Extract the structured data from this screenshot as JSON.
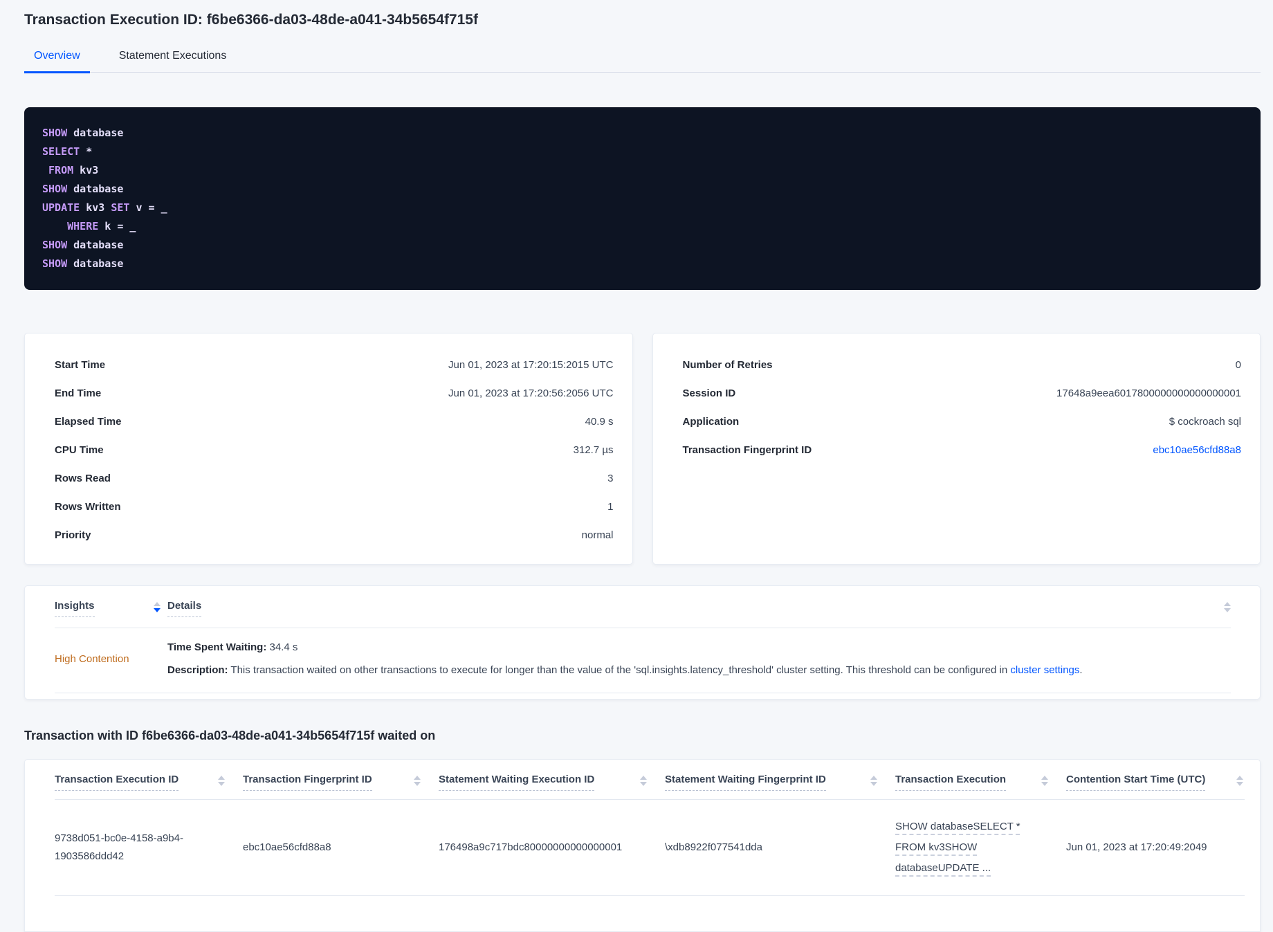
{
  "header": {
    "title": "Transaction Execution ID: f6be6366-da03-48de-a041-34b5654f715f",
    "tabs": [
      {
        "label": "Overview",
        "active": true
      },
      {
        "label": "Statement Executions",
        "active": false
      }
    ]
  },
  "sql": {
    "lines": [
      {
        "parts": [
          {
            "text": "SHOW"
          },
          {
            "text": " database"
          }
        ]
      },
      {
        "parts": [
          {
            "text": "SELECT"
          },
          {
            "text": " *"
          }
        ]
      },
      {
        "parts": [
          {
            "text": " "
          },
          {
            "text": "FROM"
          },
          {
            "text": " kv3"
          }
        ]
      },
      {
        "parts": [
          {
            "text": "SHOW"
          },
          {
            "text": " database"
          }
        ]
      },
      {
        "parts": [
          {
            "text": "UPDATE"
          },
          {
            "text": " kv3 "
          },
          {
            "text": "SET"
          },
          {
            "text": " v = _"
          }
        ]
      },
      {
        "parts": [
          {
            "text": "    "
          },
          {
            "text": "WHERE"
          },
          {
            "text": " k = _"
          }
        ]
      },
      {
        "parts": [
          {
            "text": "SHOW"
          },
          {
            "text": " database"
          }
        ]
      },
      {
        "parts": [
          {
            "text": "SHOW"
          },
          {
            "text": " database"
          }
        ]
      }
    ]
  },
  "summary": {
    "left": {
      "rows": [
        {
          "label": "Start Time",
          "value": "Jun 01, 2023 at 17:20:15:2015 UTC"
        },
        {
          "label": "End Time",
          "value": "Jun 01, 2023 at 17:20:56:2056 UTC"
        },
        {
          "label": "Elapsed Time",
          "value": "40.9 s"
        },
        {
          "label": "CPU Time",
          "value": "312.7 µs"
        },
        {
          "label": "Rows Read",
          "value": "3"
        },
        {
          "label": "Rows Written",
          "value": "1"
        },
        {
          "label": "Priority",
          "value": "normal"
        }
      ]
    },
    "right": {
      "rows": [
        {
          "label": "Number of Retries",
          "value": "0"
        },
        {
          "label": "Session ID",
          "value": "17648a9eea6017800000000000000001"
        },
        {
          "label": "Application",
          "value": "$ cockroach sql"
        },
        {
          "label": "Transaction Fingerprint ID",
          "value": "ebc10ae56cfd88a8"
        }
      ]
    }
  },
  "insights": {
    "columns": [
      "Insights",
      "Details"
    ],
    "row": {
      "insight": "High Contention",
      "waiting_label": "Time Spent Waiting:",
      "waiting_value": " 34.4 s",
      "description_label": "Description:",
      "description_text": " This transaction waited on other transactions to execute for longer than the value of the 'sql.insights.latency_threshold' cluster setting. This threshold can be configured in ",
      "description_link": "cluster settings",
      "description_suffix": "."
    }
  },
  "waited_on": {
    "heading": "Transaction with ID f6be6366-da03-48de-a041-34b5654f715f waited on",
    "columns": [
      "Transaction Execution ID",
      "Transaction Fingerprint ID",
      "Statement Waiting Execution ID",
      "Statement Waiting Fingerprint ID",
      "Transaction Execution",
      "Contention Start Time (UTC)"
    ],
    "rows": [
      {
        "transaction_execution_id": "9738d051-bc0e-4158-a9b4-1903586ddd42",
        "transaction_fingerprint_id": "ebc10ae56cfd88a8",
        "statement_waiting_execution_id": "176498a9c717bdc80000000000000001",
        "statement_waiting_fingerprint_id": "\\xdb8922f077541dda",
        "transaction_execution": "SHOW databaseSELECT * FROM kv3SHOW databaseUPDATE ...",
        "contention_start_time": "Jun 01, 2023 at 17:20:49:2049"
      }
    ]
  },
  "colors": {
    "accent_blue": "#0055ff",
    "insight_orange": "#bf6c1e",
    "sql_background": "#0d1423",
    "sql_keyword": "#c49af7",
    "sql_text": "#e3def9",
    "page_background": "#f5f7fa",
    "heading_text": "#242a35",
    "body_text": "#394455"
  }
}
